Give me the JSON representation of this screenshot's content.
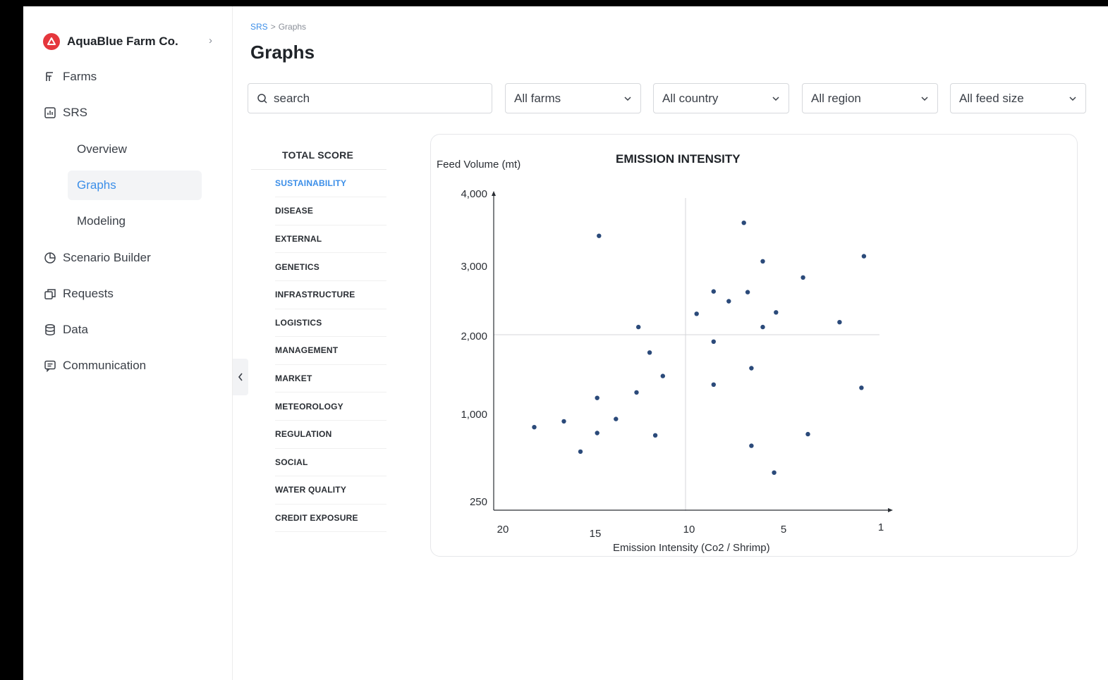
{
  "sidebar": {
    "org_name": "AquaBlue Farm Co.",
    "nav": [
      {
        "label": "Farms",
        "icon": "farm-icon"
      },
      {
        "label": "SRS",
        "icon": "chart-box-icon"
      },
      {
        "label": "Scenario Builder",
        "icon": "pie-clock-icon"
      },
      {
        "label": "Requests",
        "icon": "requests-icon"
      },
      {
        "label": "Data",
        "icon": "database-icon"
      },
      {
        "label": "Communication",
        "icon": "message-icon"
      }
    ],
    "srs_sub": [
      {
        "label": "Overview"
      },
      {
        "label": "Graphs"
      },
      {
        "label": "Modeling"
      }
    ],
    "active_sub": "Graphs"
  },
  "breadcrumb": {
    "root": "SRS",
    "separator": ">",
    "current": "Graphs"
  },
  "page_title": "Graphs",
  "filters": {
    "search_placeholder": "search",
    "selects": [
      {
        "value": "All farms"
      },
      {
        "value": "All country"
      },
      {
        "value": "All region"
      },
      {
        "value": "All feed size"
      }
    ]
  },
  "categories": {
    "total": "TOTAL SCORE",
    "items": [
      "SUSTAINABILITY",
      "DISEASE",
      "EXTERNAL",
      "GENETICS",
      "INFRASTRUCTURE",
      "LOGISTICS",
      "MANAGEMENT",
      "MARKET",
      "METEOROLOGY",
      "REGULATION",
      "SOCIAL",
      "WATER QUALITY",
      "CREDIT EXPOSURE"
    ],
    "active": "SUSTAINABILITY"
  },
  "colors": {
    "accent": "#3b8ee8",
    "point": "#2b4a7a",
    "logo": "#e5373d"
  },
  "chart_data": {
    "type": "scatter",
    "title": "EMISSION INTENSITY",
    "xlabel": "Emission Intensity (Co2 / Shrimp)",
    "ylabel": "Feed Volume (mt)",
    "x_ticks": [
      20,
      15,
      10,
      5,
      1
    ],
    "y_ticks": [
      "4,000",
      "3,000",
      "2,000",
      "1,000",
      "250"
    ],
    "x_reversed": true,
    "grid": "center crosshair",
    "points": [
      {
        "x": 18.3,
        "y": 890
      },
      {
        "x": 16.7,
        "y": 940
      },
      {
        "x": 15.8,
        "y": 680
      },
      {
        "x": 14.9,
        "y": 1210
      },
      {
        "x": 14.9,
        "y": 840
      },
      {
        "x": 14.8,
        "y": 3420
      },
      {
        "x": 13.9,
        "y": 960
      },
      {
        "x": 12.8,
        "y": 1280
      },
      {
        "x": 12.7,
        "y": 2130
      },
      {
        "x": 12.1,
        "y": 1790
      },
      {
        "x": 11.8,
        "y": 820
      },
      {
        "x": 11.4,
        "y": 1490
      },
      {
        "x": 9.6,
        "y": 2320
      },
      {
        "x": 8.7,
        "y": 1380
      },
      {
        "x": 8.7,
        "y": 1930
      },
      {
        "x": 8.7,
        "y": 2640
      },
      {
        "x": 7.9,
        "y": 2500
      },
      {
        "x": 7.1,
        "y": 3600
      },
      {
        "x": 6.9,
        "y": 2630
      },
      {
        "x": 6.7,
        "y": 1590
      },
      {
        "x": 6.7,
        "y": 730
      },
      {
        "x": 6.1,
        "y": 3070
      },
      {
        "x": 6.1,
        "y": 2130
      },
      {
        "x": 5.4,
        "y": 2340
      },
      {
        "x": 5.5,
        "y": 500
      },
      {
        "x": 4.2,
        "y": 2840
      },
      {
        "x": 4.0,
        "y": 830
      },
      {
        "x": 2.7,
        "y": 2200
      },
      {
        "x": 1.8,
        "y": 1340
      },
      {
        "x": 1.7,
        "y": 3140
      }
    ]
  }
}
